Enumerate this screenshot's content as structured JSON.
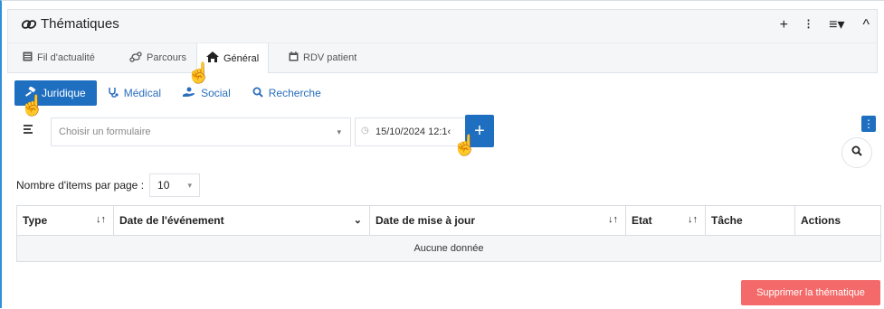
{
  "header": {
    "title": "Thématiques",
    "actions": [
      "+",
      "⁝",
      "≡▾",
      "^"
    ]
  },
  "tabs": [
    {
      "label": "Fil d'actualité"
    },
    {
      "label": "Parcours"
    },
    {
      "label": "Général"
    },
    {
      "label": "RDV patient"
    }
  ],
  "subtabs": [
    {
      "label": "Juridique"
    },
    {
      "label": "Médical"
    },
    {
      "label": "Social"
    },
    {
      "label": "Recherche"
    }
  ],
  "form": {
    "select_placeholder": "Choisir un formulaire",
    "date_value": "15/10/2024 12:1‹",
    "add_label": "+"
  },
  "pager": {
    "label": "Nombre d'items par page :",
    "value": "10"
  },
  "table": {
    "columns": [
      "Type",
      "Date de l'événement",
      "Date de mise à jour",
      "Etat",
      "Tâche",
      "Actions"
    ],
    "empty_text": "Aucune donnée"
  },
  "delete_button": "Supprimer la thématique",
  "colors": {
    "primary": "#1f6fc1",
    "danger": "#f46a6a",
    "frame_accent": "#2f8fd8"
  }
}
